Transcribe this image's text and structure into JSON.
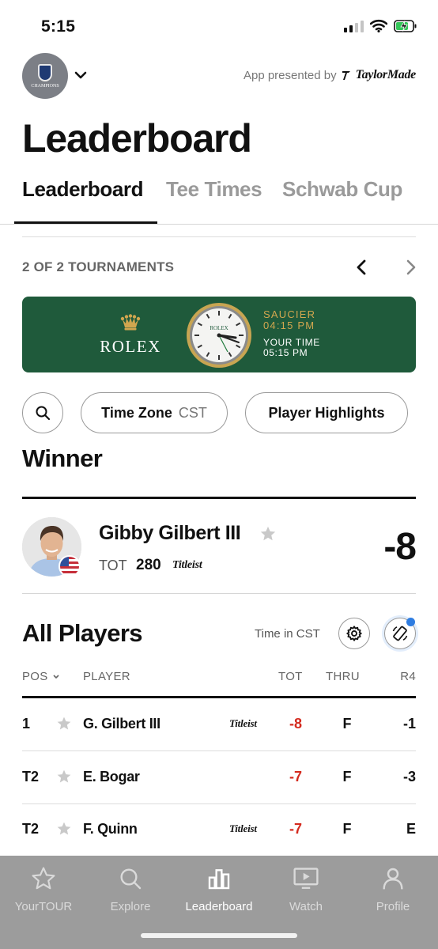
{
  "status_bar": {
    "time": "5:15"
  },
  "header": {
    "tour_logo_label": "CHAMPIONS",
    "presented_by": "App presented by",
    "sponsor": "TaylorMade"
  },
  "page_title": "Leaderboard",
  "tabs": [
    {
      "label": "Leaderboard",
      "active": true
    },
    {
      "label": "Tee Times",
      "active": false
    },
    {
      "label": "Schwab Cup",
      "active": false
    }
  ],
  "tournaments": {
    "count_label": "2 OF 2 TOURNAMENTS"
  },
  "rolex_banner": {
    "brand": "ROLEX",
    "dial_brand": "ROLEX",
    "location": "SAUCIER",
    "location_time": "04:15 PM",
    "your_time_label": "YOUR TIME",
    "your_time": "05:15 PM"
  },
  "filters": {
    "time_zone_label": "Time Zone",
    "time_zone_value": "CST",
    "highlights_label": "Player Highlights"
  },
  "winner": {
    "section_title": "Winner",
    "name": "Gibby Gilbert III",
    "tot_label": "TOT",
    "tot_value": "280",
    "equipment": "Titleist",
    "score": "-8"
  },
  "all_players": {
    "section_title": "All Players",
    "time_note": "Time in CST",
    "columns": {
      "pos": "POS",
      "player": "PLAYER",
      "tot": "TOT",
      "thru": "THRU",
      "r4": "R4"
    },
    "rows": [
      {
        "pos": "1",
        "name": "G. Gilbert III",
        "equipment": "Titleist",
        "tot": "-8",
        "thru": "F",
        "r4": "-1"
      },
      {
        "pos": "T2",
        "name": "E. Bogar",
        "equipment": "",
        "tot": "-7",
        "thru": "F",
        "r4": "-3"
      },
      {
        "pos": "T2",
        "name": "F. Quinn",
        "equipment": "Titleist",
        "tot": "-7",
        "thru": "F",
        "r4": "E"
      }
    ]
  },
  "tab_bar": [
    {
      "label": "YourTOUR",
      "icon": "star-icon",
      "active": false
    },
    {
      "label": "Explore",
      "icon": "search-icon",
      "active": false
    },
    {
      "label": "Leaderboard",
      "icon": "leaderboard-icon",
      "active": true
    },
    {
      "label": "Watch",
      "icon": "watch-icon",
      "active": false
    },
    {
      "label": "Profile",
      "icon": "profile-icon",
      "active": false
    }
  ],
  "colors": {
    "rolex_green": "#1f5a3b",
    "rolex_gold": "#d1a64f",
    "under_par_red": "#d42a1e",
    "notification_blue": "#2f7de1"
  }
}
